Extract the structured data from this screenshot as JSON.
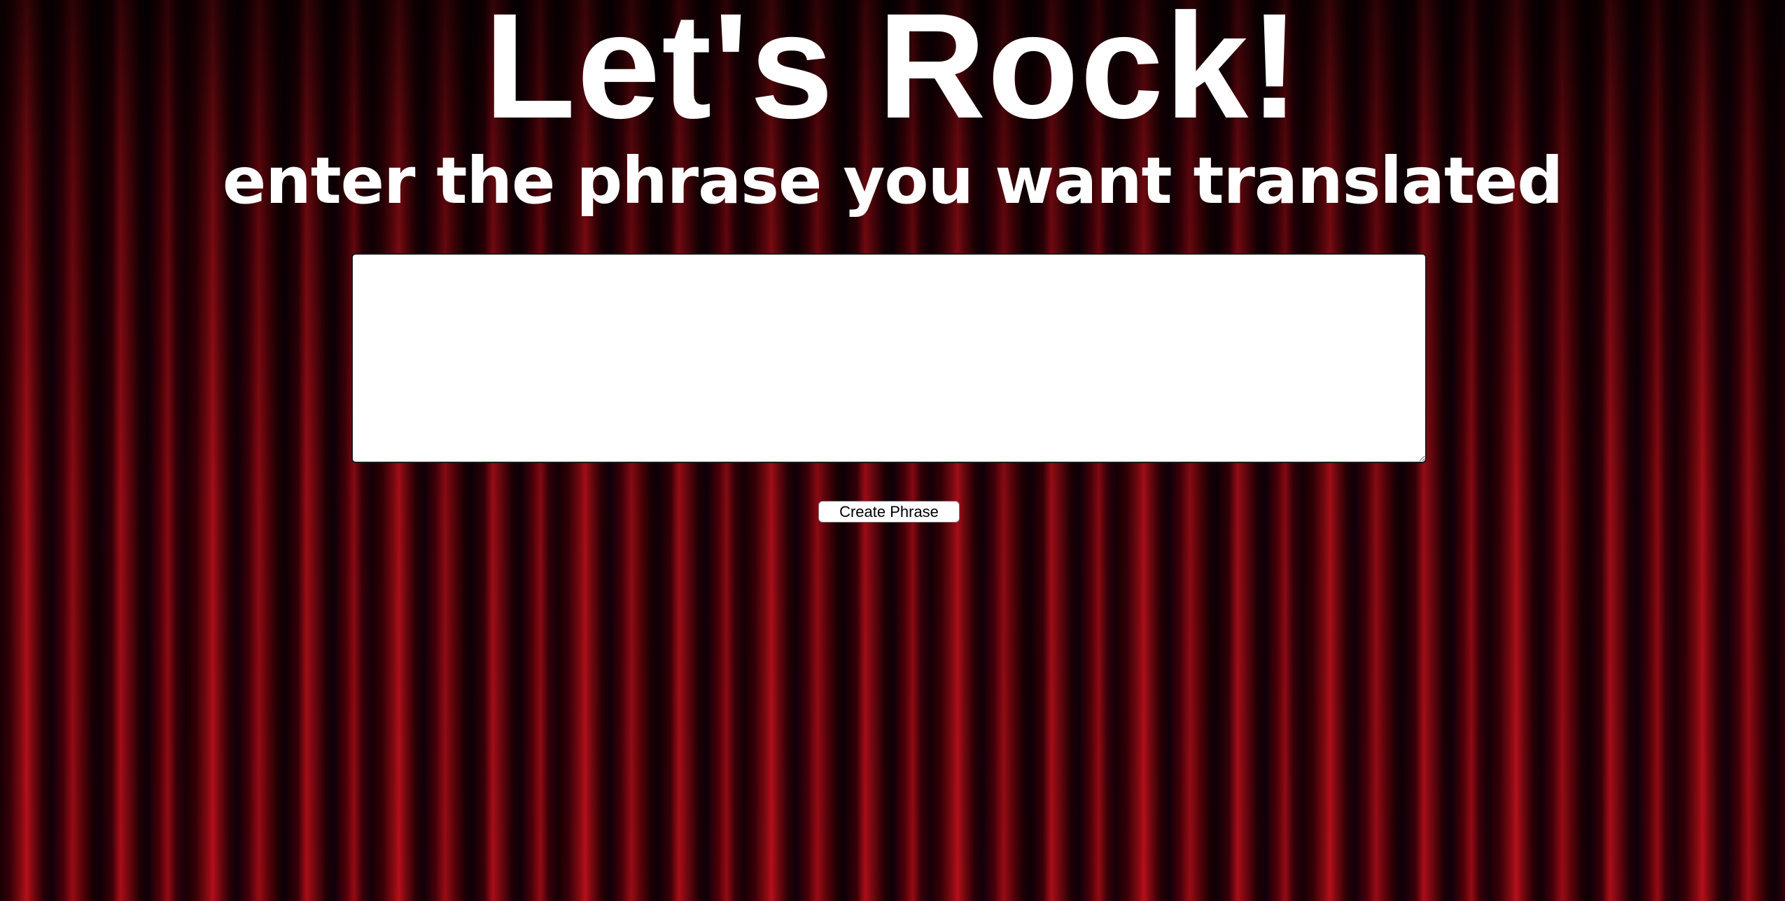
{
  "page": {
    "title": "Let's Rock!",
    "subtitle": "enter the phrase you want translated"
  },
  "form": {
    "phrase_value": "",
    "submit_label": "Create Phrase"
  },
  "colors": {
    "text": "#ffffff",
    "curtain_red": "#b30e1a",
    "curtain_dark": "#1a0003",
    "input_background": "#ffffff"
  }
}
